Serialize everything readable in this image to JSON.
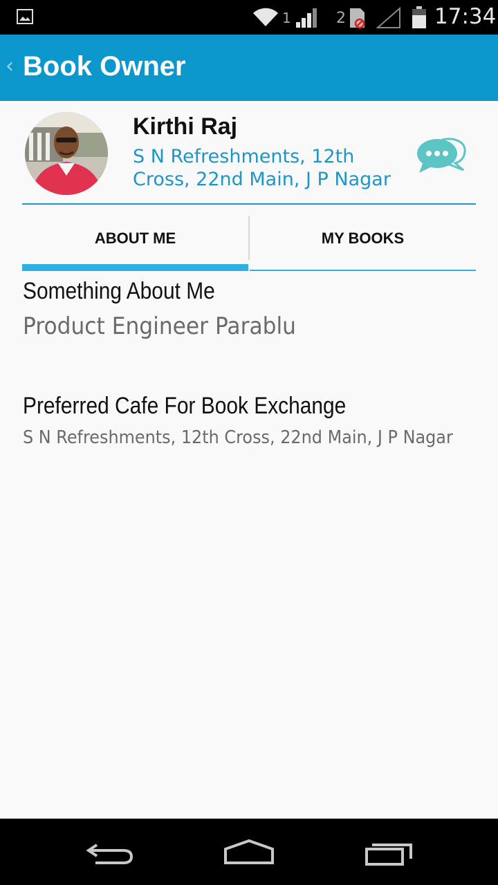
{
  "status_bar": {
    "sim1_label": "1",
    "sim2_label": "2",
    "time": "17:34",
    "icons": [
      "gallery-icon",
      "wifi-icon",
      "signal-icon",
      "sim-blocked-icon",
      "signal-empty-icon",
      "battery-icon"
    ]
  },
  "action_bar": {
    "back_glyph": "‹",
    "title": "Book Owner",
    "color": "#0b97cc"
  },
  "profile": {
    "name": "Kirthi Raj",
    "address": "S N Refreshments, 12th Cross, 22nd Main, J P Nagar",
    "chat_icon": "chat-bubbles-icon",
    "accent_color": "#1e95c8"
  },
  "tabs": [
    {
      "label": "ABOUT ME",
      "selected": true
    },
    {
      "label": "MY BOOKS",
      "selected": false
    }
  ],
  "about": {
    "heading": "Something About Me",
    "value": "Product Engineer Parablu"
  },
  "cafe": {
    "heading": "Preferred Cafe For Book Exchange",
    "value": "S N Refreshments, 12th Cross, 22nd Main, J P Nagar"
  },
  "nav_bar": {
    "icons": [
      "back-icon",
      "home-icon",
      "recents-icon"
    ]
  }
}
